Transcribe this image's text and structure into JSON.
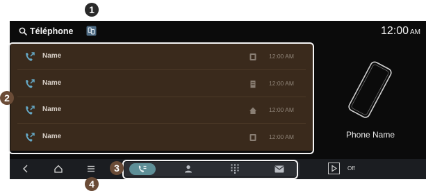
{
  "header": {
    "title": "Téléphone",
    "time": "12:00",
    "ampm": "AM"
  },
  "call_list": [
    {
      "name": "Name",
      "direction_icon": "outgoing-call-icon",
      "type_icon": "mobile-phone-icon",
      "time": "12:00 AM"
    },
    {
      "name": "Name",
      "direction_icon": "outgoing-call-icon",
      "type_icon": "office-building-icon",
      "time": "12:00 AM"
    },
    {
      "name": "Name",
      "direction_icon": "outgoing-call-icon",
      "type_icon": "home-icon",
      "time": "12:00 AM"
    },
    {
      "name": "Name",
      "direction_icon": "outgoing-call-icon",
      "type_icon": "mobile-phone-icon",
      "time": "12:00 AM"
    }
  ],
  "device": {
    "name": "Phone Name"
  },
  "bottom_bar": {
    "nav": [
      "back-icon",
      "home-icon",
      "menu-icon"
    ],
    "tabs": [
      {
        "icon": "call-history-icon",
        "active": true
      },
      {
        "icon": "contacts-icon",
        "active": false
      },
      {
        "icon": "dialpad-icon",
        "active": false
      },
      {
        "icon": "messages-icon",
        "active": false
      }
    ],
    "media_label": "Off"
  },
  "callouts": [
    "1",
    "2",
    "3",
    "4"
  ],
  "colors": {
    "screen_bg": "#0b0b0b",
    "list_bg": "#3a2a1c",
    "accent": "#5e8f97",
    "call_icon": "#66a9c7",
    "callout_dark": "#2a2a2a",
    "callout_brown": "#6b4c37"
  }
}
